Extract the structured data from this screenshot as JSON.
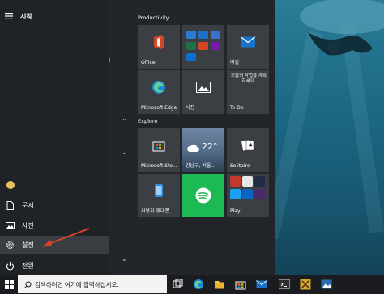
{
  "start_menu": {
    "header_label": "시작",
    "rail_items": [
      {
        "label": "문서",
        "icon": "document-icon"
      },
      {
        "label": "사진",
        "icon": "pictures-icon"
      },
      {
        "label": "설정",
        "icon": "gear-icon"
      },
      {
        "label": "전원",
        "icon": "power-icon"
      }
    ]
  },
  "groups": [
    {
      "title": "Productivity"
    },
    {
      "title": "Explore"
    }
  ],
  "tiles": {
    "office": "Office",
    "mail": "메일",
    "edge": "Microsoft Edge",
    "photos": "사진",
    "todo_note": "오늘의 작업을 계획하세요.",
    "todo": "To Do",
    "store": "Microsoft Sto...",
    "weather_temp": "22°",
    "weather_loc": "강남구, 서울...",
    "solitaire": "Solitaire",
    "phone": "사용자 휴대폰",
    "play": "Play"
  },
  "taskbar": {
    "search_placeholder": "검색하려면 여기에 입력하십시오."
  },
  "colors": {
    "accent_red": "#d04a2a",
    "spotify": "#1db954",
    "mail_blue": "#1a73c8"
  }
}
